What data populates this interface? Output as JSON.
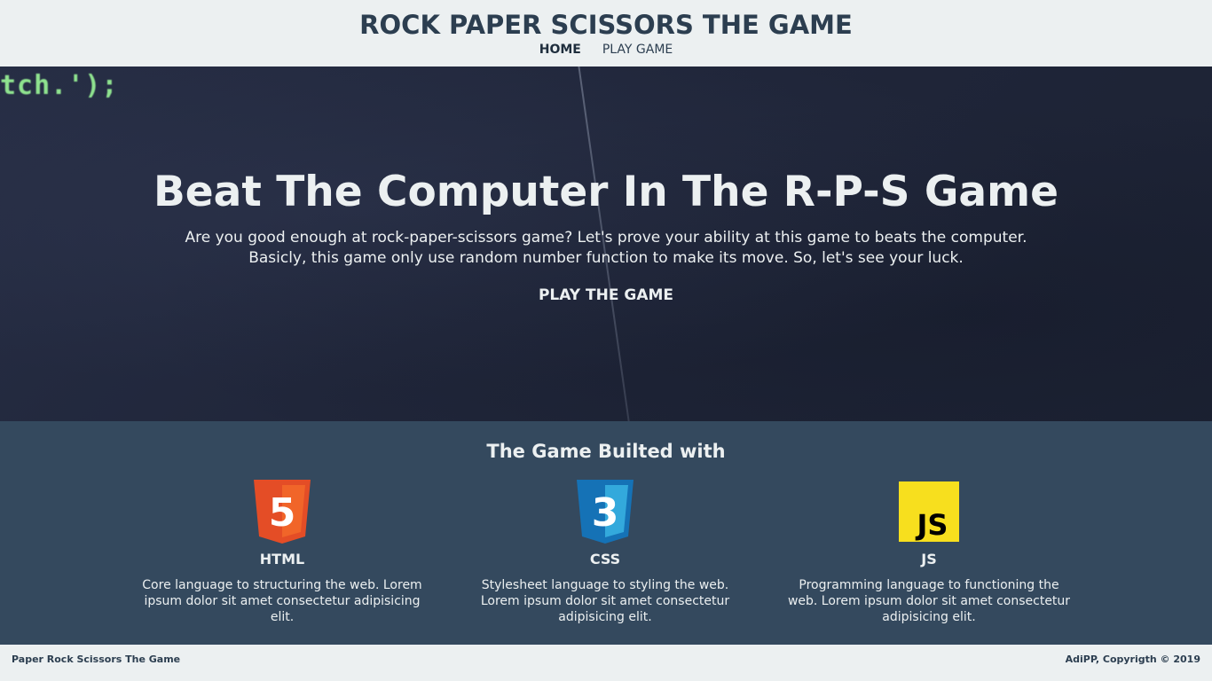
{
  "header": {
    "title": "ROCK PAPER SCISSORS THE GAME",
    "nav": [
      {
        "label": "HOME",
        "active": true
      },
      {
        "label": "PLAY GAME",
        "active": false
      }
    ]
  },
  "hero": {
    "code_snippet": "tch.');",
    "heading": "Beat The Computer In The R-P-S Game",
    "text_line1": "Are you good enough at rock-paper-scissors game? Let's prove your ability at this game to beats the computer.",
    "text_line2": "Basicly, this game only use random number function to make its move. So, let's see your luck.",
    "cta_label": "PLAY THE GAME"
  },
  "tech": {
    "title": "The Game Builted with",
    "items": [
      {
        "icon": "html5-icon",
        "logo_text": "5",
        "name": "HTML",
        "description": "Core language to structuring the web. Lorem ipsum dolor sit amet consectetur adipisicing elit."
      },
      {
        "icon": "css3-icon",
        "logo_text": "3",
        "name": "CSS",
        "description": "Stylesheet language to styling the web. Lorem ipsum dolor sit amet consectetur adipisicing elit."
      },
      {
        "icon": "js-icon",
        "logo_text": "JS",
        "name": "JS",
        "description": "Programming language to functioning the web. Lorem ipsum dolor sit amet consectetur adipisicing elit."
      }
    ]
  },
  "footer": {
    "left": "Paper Rock Scissors The Game",
    "right": "AdiPP, Copyrigth © 2019"
  },
  "colors": {
    "header_bg": "#ecf0f1",
    "title": "#2c3e50",
    "hero_bg": "#232a3f",
    "tech_bg": "#34495e",
    "html_orange": "#e44d26",
    "css_blue": "#1572b6",
    "js_yellow": "#f7df1e"
  }
}
